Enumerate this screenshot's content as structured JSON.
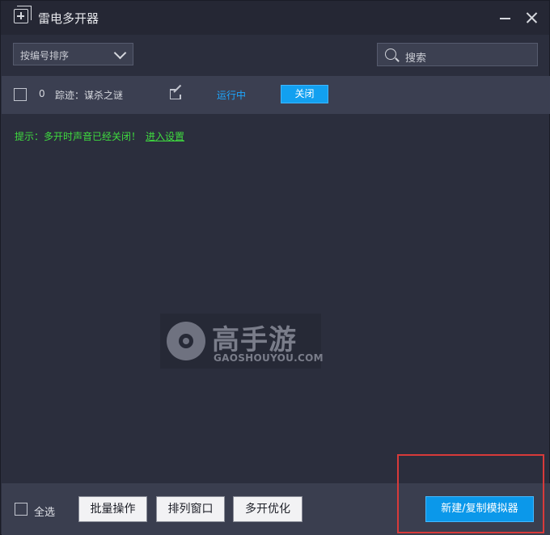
{
  "window": {
    "title": "雷电多开器"
  },
  "toolbar": {
    "sort_select": "按编号排序",
    "search_placeholder": "搜索"
  },
  "instances": [
    {
      "index": "0",
      "name": "踪迹：谋杀之谜",
      "status": "运行中",
      "action_label": "关闭",
      "status_color": "#1ea7ff"
    }
  ],
  "hint": {
    "text": "提示：多开时声音已经关闭！",
    "link": "进入设置",
    "color": "#3fdc3f"
  },
  "watermark": {
    "cn": "高手游",
    "en": "GAOSHOUYOU.COM"
  },
  "bottom": {
    "select_all": "全选",
    "batch_ops": "批量操作",
    "arrange_windows": "排列窗口",
    "optimize": "多开优化",
    "new_copy": "新建/复制模拟器"
  },
  "colors": {
    "accent": "#12a0f0",
    "highlight_box": "#d83a3a",
    "background": "#2b2e3d"
  }
}
